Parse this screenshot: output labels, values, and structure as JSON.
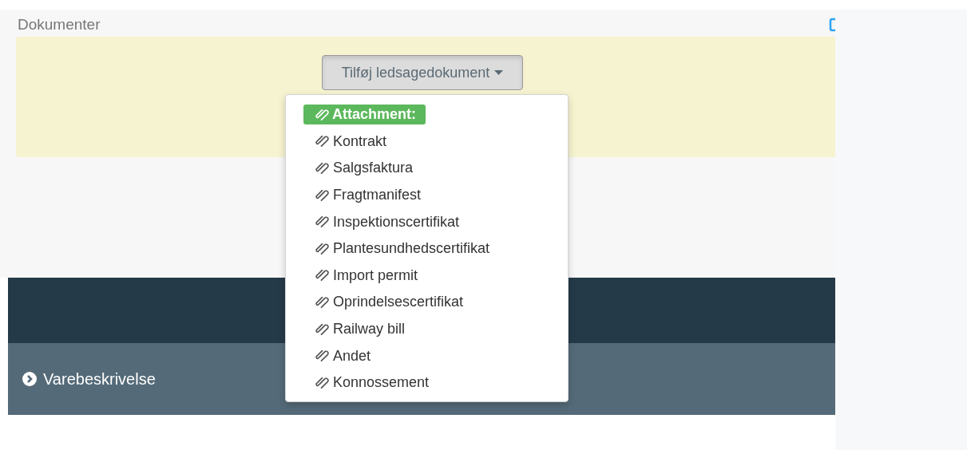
{
  "section": {
    "title": "Dokumenter"
  },
  "dropdown": {
    "label": "Tilføj ledsagedokument",
    "expanded": true,
    "items": [
      {
        "kind": "header",
        "label": "Attachment:"
      },
      {
        "kind": "item",
        "label": "Kontrakt"
      },
      {
        "kind": "item",
        "label": "Salgsfaktura"
      },
      {
        "kind": "item",
        "label": "Fragtmanifest"
      },
      {
        "kind": "item",
        "label": "Inspektionscertifikat"
      },
      {
        "kind": "item",
        "label": "Plantesundhedscertifikat"
      },
      {
        "kind": "item",
        "label": "Import permit"
      },
      {
        "kind": "item",
        "label": "Oprindelsescertifikat"
      },
      {
        "kind": "item",
        "label": "Railway bill"
      },
      {
        "kind": "item",
        "label": "Andet"
      },
      {
        "kind": "item",
        "label": "Konnossement"
      }
    ]
  },
  "collapsible": {
    "label": "Varebeskrivelse",
    "expanded": false
  }
}
